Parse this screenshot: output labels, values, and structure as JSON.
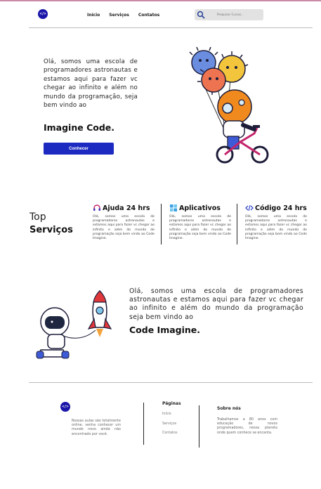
{
  "header": {
    "logo_glyph": "</>",
    "nav": [
      "Início",
      "Serviços",
      "Contatos"
    ],
    "search_placeholder": "Pesquisar Cursos..."
  },
  "hero": {
    "text": "Olá, somos uma escola de programadores astronautas e estamos aqui para fazer vc chegar ao infinito e além no mundo da programação, seja bem vindo ao",
    "title": "Imagine Code.",
    "button": "Conhecer"
  },
  "services": {
    "title_line1": "Top",
    "title_line2": "Serviços",
    "cards": [
      {
        "icon": "headset-icon",
        "title": "Ajuda 24 hrs",
        "desc": "Olá, somos uma escola de programadores astronautas e estamos aqui para fazer vc chegar ao infinito e além do mundo de programação seja bem vindo ao Code Imagine."
      },
      {
        "icon": "apps-icon",
        "title": "Aplicativos",
        "desc": "Olá, somos uma escola de programadores astronautas e estamos aqui para fazer vc chegar ao infinito e além do mundo de programação seja bem vindo ao Code Imagine."
      },
      {
        "icon": "code-icon",
        "title": "Código 24 hrs",
        "desc": "Olá, somos uma escola de programadores astronautas e estamos aqui para fazer vc chegar ao infinito e além do mundo de programação seja bem vindo ao Code Imagine."
      }
    ]
  },
  "section2": {
    "text": "Olá, somos uma escola de programadores astronautas e estamos aqui para fazer vc chegar ao infinito e além do mundo da programação seja bem vindo ao",
    "title": "Code Imagine."
  },
  "footer": {
    "logo_glyph": "</>",
    "desc": "Nossas aulas são totalmente online, venha conhecer um mundo novo ainda não encontrado por você.",
    "pages_title": "Páginas",
    "pages": [
      "Início",
      "Serviços",
      "Contatos"
    ],
    "about_title": "Sobre nós",
    "about": "Trabalhamos a 80 anos com educação de novos programadores, nessa planeta onde quem conhece se encanta."
  },
  "colors": {
    "brand": "#1a16a8",
    "button": "#1c2ac2"
  }
}
